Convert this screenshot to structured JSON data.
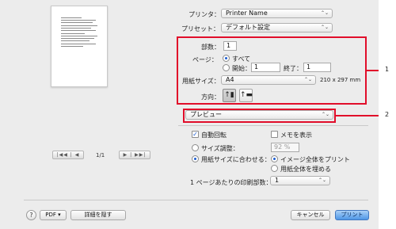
{
  "printer": {
    "label": "プリンタ：",
    "value": "Printer Name"
  },
  "presets": {
    "label": "プリセット：",
    "value": "デフォルト設定"
  },
  "copies": {
    "label": "部数：",
    "value": "1"
  },
  "pages": {
    "label": "ページ：",
    "all_label": "すべて",
    "from_label": "開始：",
    "from_value": "1",
    "to_label": "終了：",
    "to_value": "1"
  },
  "paper_size": {
    "label": "用紙サイズ：",
    "value": "A4",
    "dimensions": "210 x 297 mm"
  },
  "orientation": {
    "label": "方向："
  },
  "section_popup": {
    "value": "プレビュー"
  },
  "preview_options": {
    "auto_rotate_label": "自動回転",
    "show_notes_label": "メモを表示",
    "scale_label": "サイズ調整：",
    "scale_value": "92 %",
    "fit_label": "用紙サイズに合わせる：",
    "print_entire_label": "イメージ全体をプリント",
    "fill_paper_label": "用紙全体を埋める",
    "copies_per_page_label": "1 ページあたりの印刷部数：",
    "copies_per_page_value": "1"
  },
  "page_nav": {
    "count": "1/1"
  },
  "footer": {
    "help": "?",
    "pdf": "PDF",
    "hide_details": "詳細を隠す",
    "cancel": "キャンセル",
    "print": "プリント"
  },
  "callouts": [
    "1",
    "2"
  ],
  "colors": {
    "callout": "#e10d2a",
    "accent": "#1a5bd0",
    "default_button": "#4f97e6"
  }
}
